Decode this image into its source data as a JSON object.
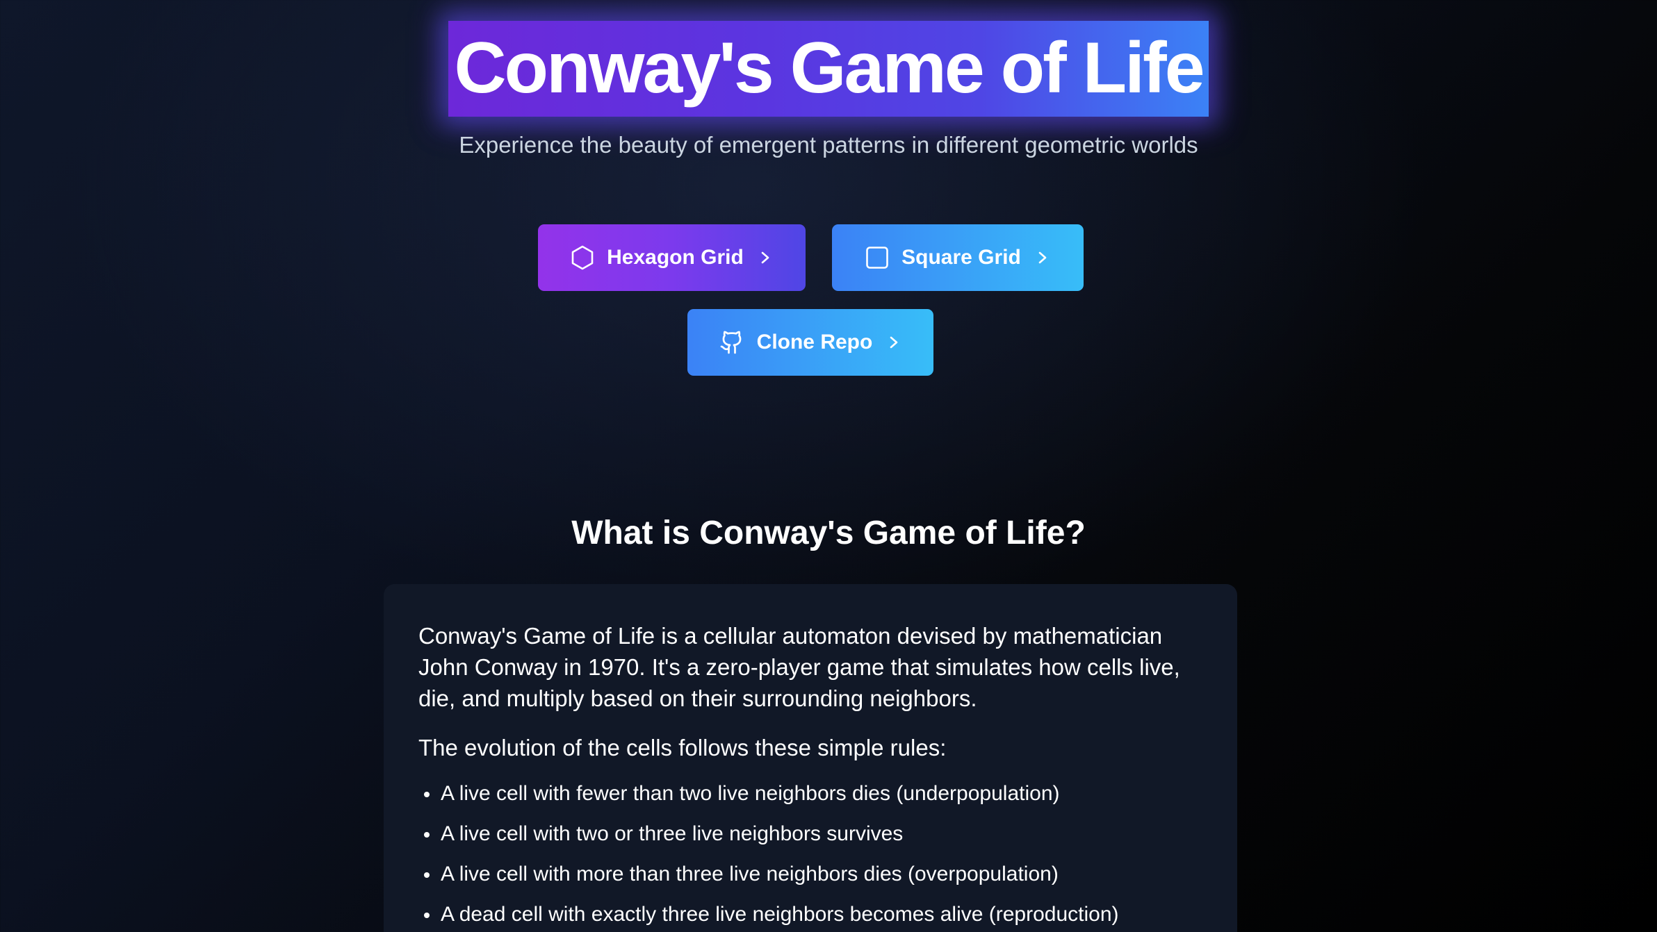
{
  "header": {
    "title": "Conway's Game of Life",
    "subtitle": "Experience the beauty of emergent patterns in different geometric worlds"
  },
  "buttons": {
    "hexagon": {
      "label": "Hexagon Grid",
      "icon": "hexagon-icon"
    },
    "square": {
      "label": "Square Grid",
      "icon": "square-icon"
    },
    "repo": {
      "label": "Clone Repo",
      "icon": "github-icon"
    },
    "chevron_icon": "chevron-right-icon"
  },
  "about": {
    "heading": "What is Conway's Game of Life?",
    "intro": "Conway's Game of Life is a cellular automaton devised by mathematician John Conway in 1970. It's a zero-player game that simulates how cells live, die, and multiply based on their surrounding neighbors.",
    "rules_lead": "The evolution of the cells follows these simple rules:",
    "rules": [
      "A live cell with fewer than two live neighbors dies (underpopulation)",
      "A live cell with two or three live neighbors survives",
      "A live cell with more than three live neighbors dies (overpopulation)",
      "A dead cell with exactly three live neighbors becomes alive (reproduction)"
    ]
  },
  "colors": {
    "background": "#0b1120",
    "card": "#111827",
    "purple": "#7c3aed",
    "indigo": "#4f46e5",
    "blue": "#3b82f6",
    "cyan": "#38bdf8",
    "subtitle": "#cbd5e1"
  }
}
